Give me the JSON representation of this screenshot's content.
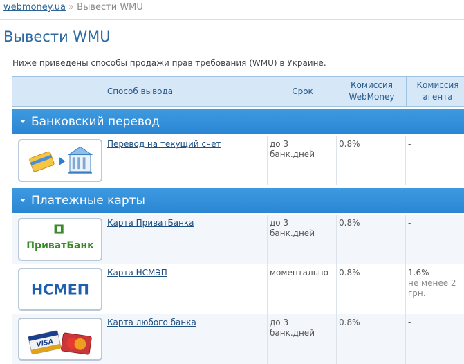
{
  "breadcrumb": {
    "home": "webmoney.ua",
    "sep": "»",
    "current": "Вывести WMU"
  },
  "page_title": "Вывести WMU",
  "intro": "Ниже приведены способы продажи прав требования (WMU) в Украине.",
  "columns": {
    "method": "Способ вывода",
    "term": "Срок",
    "wm_fee": "Комиссия WebMoney",
    "agent_fee": "Комиссия агента"
  },
  "sections": [
    {
      "title": "Банковский перевод",
      "rows": [
        {
          "logo_icon": "card-to-bank-icon",
          "name": "Перевод на текущий счет",
          "term": "до 3 банк.дней",
          "wm_fee": "0.8%",
          "agent_fee": "-",
          "agent_fee_note": ""
        }
      ]
    },
    {
      "title": "Платежные карты",
      "rows": [
        {
          "logo_icon": "privatbank-logo",
          "logo_text": "ПриватБанк",
          "name": "Карта ПриватБанка",
          "term": "до 3 банк.дней",
          "wm_fee": "0.8%",
          "agent_fee": "-",
          "agent_fee_note": ""
        },
        {
          "logo_icon": "nsmep-logo",
          "logo_text": "НСМЕП",
          "name": "Карта НСМЭП",
          "term": "моментально",
          "wm_fee": "0.8%",
          "agent_fee": "1.6%",
          "agent_fee_note": "не менее 2 грн."
        },
        {
          "logo_icon": "visa-mastercard-icon",
          "logo_text": "VISA",
          "name": "Карта любого банка",
          "term": "до 3 банк.дней",
          "wm_fee": "0.8%",
          "agent_fee": "-",
          "agent_fee_note": ""
        }
      ]
    }
  ],
  "colors": {
    "title": "#2d6aa3",
    "section_bar": "#2a86d3",
    "header_bg": "#d6e7f7",
    "privat_green": "#3a8a2c",
    "nsmep_blue": "#1f5fb0"
  }
}
